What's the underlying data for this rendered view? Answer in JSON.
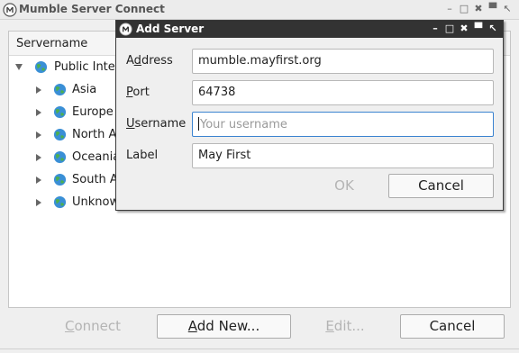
{
  "window": {
    "title": "Mumble Server Connect",
    "icon": "mumble-logo-icon",
    "buttons": [
      "–",
      "□",
      "✖",
      "▀",
      "↖"
    ]
  },
  "server_list": {
    "column_header": "Servername",
    "root": {
      "label": "Public Inte",
      "expanded": true,
      "icon": "globe-icon"
    },
    "regions": [
      {
        "label": "Asia"
      },
      {
        "label": "Europe"
      },
      {
        "label": "North A"
      },
      {
        "label": "Oceania"
      },
      {
        "label": "South A"
      },
      {
        "label": "Unknow"
      }
    ]
  },
  "bottom_buttons": {
    "connect": {
      "prefix": "",
      "underline": "C",
      "rest": "onnect",
      "enabled": false
    },
    "add_new": {
      "prefix": "",
      "underline": "A",
      "rest": "dd New...",
      "enabled": true
    },
    "edit": {
      "prefix": "",
      "underline": "E",
      "rest": "dit...",
      "enabled": false
    },
    "cancel": {
      "label": "Cancel",
      "enabled": true
    }
  },
  "add_server_dialog": {
    "title": "Add Server",
    "icon": "mumble-logo-icon",
    "fields": {
      "address": {
        "label_pre": "A",
        "label_ul": "d",
        "label_post": "dress",
        "value": "mumble.mayfirst.org"
      },
      "port": {
        "label_pre": "",
        "label_ul": "P",
        "label_post": "ort",
        "value": "64738"
      },
      "username": {
        "label_pre": "",
        "label_ul": "U",
        "label_post": "sername",
        "value": "",
        "placeholder": "Your username"
      },
      "label": {
        "label_pre": "",
        "label_ul": "",
        "label_post": "Label",
        "value": "May First"
      }
    },
    "ok_label": "OK",
    "cancel_label": "Cancel"
  },
  "colors": {
    "dialog_titlebar": "#333333",
    "focus_border": "#3b83d0",
    "disabled_text": "#b4b4b4"
  }
}
